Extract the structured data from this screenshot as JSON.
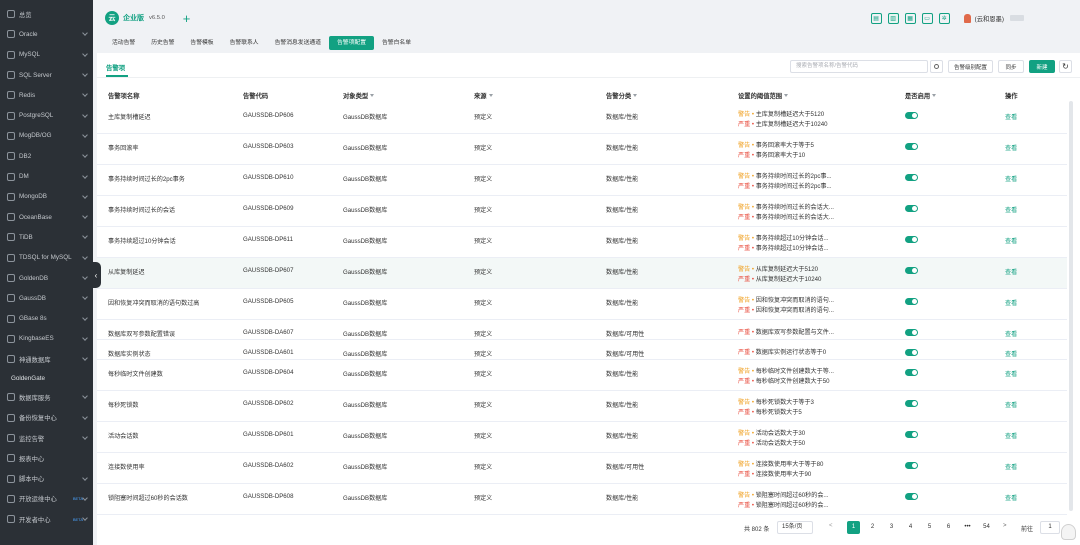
{
  "sidebar": {
    "items": [
      {
        "label": "总览",
        "icon": "dashboard-icon",
        "chevron": false
      },
      {
        "label": "Oracle",
        "icon": "oracle-icon",
        "chevron": true
      },
      {
        "label": "MySQL",
        "icon": "mysql-icon",
        "chevron": true
      },
      {
        "label": "SQL Server",
        "icon": "sqlserver-icon",
        "chevron": true
      },
      {
        "label": "Redis",
        "icon": "redis-icon",
        "chevron": true
      },
      {
        "label": "PostgreSQL",
        "icon": "postgresql-icon",
        "chevron": true
      },
      {
        "label": "MogDB/OG",
        "icon": "mogdb-icon",
        "chevron": true
      },
      {
        "label": "DB2",
        "icon": "db2-icon",
        "chevron": true
      },
      {
        "label": "DM",
        "icon": "dm-icon",
        "chevron": true
      },
      {
        "label": "MongoDB",
        "icon": "mongodb-icon",
        "chevron": true
      },
      {
        "label": "OceanBase",
        "icon": "oceanbase-icon",
        "chevron": true
      },
      {
        "label": "TiDB",
        "icon": "tidb-icon",
        "chevron": true
      },
      {
        "label": "TDSQL for MySQL",
        "icon": "tdsql-icon",
        "chevron": true
      },
      {
        "label": "GoldenDB",
        "icon": "goldendb-icon",
        "chevron": true
      },
      {
        "label": "GaussDB",
        "icon": "gaussdb-icon",
        "chevron": true
      },
      {
        "label": "GBase 8s",
        "icon": "gbase-icon",
        "chevron": true
      },
      {
        "label": "KingbaseES",
        "icon": "kingbase-icon",
        "chevron": true
      },
      {
        "label": "神通数据库",
        "icon": "shentong-icon",
        "chevron": true
      },
      {
        "label": "GoldenGate",
        "icon": "",
        "chevron": false,
        "plain": true
      },
      {
        "label": "数据库服务",
        "icon": "db-service-icon",
        "chevron": true
      },
      {
        "label": "备份恢复中心",
        "icon": "backup-icon",
        "chevron": true
      },
      {
        "label": "监控告警",
        "icon": "alarm-icon",
        "chevron": true
      },
      {
        "label": "报表中心",
        "icon": "report-icon",
        "chevron": false
      },
      {
        "label": "脚本中心",
        "icon": "script-icon",
        "chevron": true
      },
      {
        "label": "开放运维中心",
        "icon": "ops-icon",
        "chevron": true,
        "beta": "BETA"
      },
      {
        "label": "开发者中心",
        "icon": "dev-icon",
        "chevron": true,
        "beta": "BETA"
      }
    ]
  },
  "header": {
    "brand": "企业版",
    "logo_char": "云",
    "version": "v6.5.0",
    "add_tab": "+",
    "user": "(云和恩墨)"
  },
  "tabs": [
    {
      "label": "活动告警",
      "active": false
    },
    {
      "label": "历史告警",
      "active": false
    },
    {
      "label": "告警模板",
      "active": false
    },
    {
      "label": "告警联系人",
      "active": false
    },
    {
      "label": "告警消息发送通道",
      "active": false
    },
    {
      "label": "告警项配置",
      "active": true
    },
    {
      "label": "告警白名单",
      "active": false
    }
  ],
  "panel": {
    "title": "告警项",
    "search_placeholder": "搜索告警项名称/告警代码",
    "btn_level": "告警级别配置",
    "btn_sync": "同步",
    "btn_add": "新建",
    "btn_refresh": "↻"
  },
  "table": {
    "columns": [
      "告警项名称",
      "告警代码",
      "对象类型",
      "来源",
      "告警分类",
      "设置的阈值范围",
      "是否启用",
      "操作"
    ],
    "rows": [
      {
        "name": "主库复制槽延迟",
        "code": "GAUSSDB-DP606",
        "type": "GaussDB数据库",
        "source": "预定义",
        "category": "数据库/性能",
        "thresholds": [
          {
            "level": "警告",
            "text": "主库复制槽延迟大于5120"
          },
          {
            "level": "严重",
            "text": "主库复制槽延迟大于10240"
          }
        ],
        "enabled": true,
        "action": "查看"
      },
      {
        "name": "事务回滚率",
        "code": "GAUSSDB-DP603",
        "type": "GaussDB数据库",
        "source": "预定义",
        "category": "数据库/性能",
        "thresholds": [
          {
            "level": "警告",
            "text": "事务回滚率大于等于5"
          },
          {
            "level": "严重",
            "text": "事务回滚率大于10"
          }
        ],
        "enabled": true,
        "action": "查看"
      },
      {
        "name": "事务持续时间过长的2pc事务",
        "code": "GAUSSDB-DP610",
        "type": "GaussDB数据库",
        "source": "预定义",
        "category": "数据库/性能",
        "thresholds": [
          {
            "level": "警告",
            "text": "事务持续时间过长的2pc事..."
          },
          {
            "level": "严重",
            "text": "事务持续时间过长的2pc事..."
          }
        ],
        "enabled": true,
        "action": "查看"
      },
      {
        "name": "事务持续时间过长的会话",
        "code": "GAUSSDB-DP609",
        "type": "GaussDB数据库",
        "source": "预定义",
        "category": "数据库/性能",
        "thresholds": [
          {
            "level": "警告",
            "text": "事务持续时间过长的会话大..."
          },
          {
            "level": "严重",
            "text": "事务持续时间过长的会话大..."
          }
        ],
        "enabled": true,
        "action": "查看"
      },
      {
        "name": "事务持续超过10分钟会话",
        "code": "GAUSSDB-DP611",
        "type": "GaussDB数据库",
        "source": "预定义",
        "category": "数据库/性能",
        "thresholds": [
          {
            "level": "警告",
            "text": "事务持续超过10分钟会话..."
          },
          {
            "level": "严重",
            "text": "事务持续超过10分钟会话..."
          }
        ],
        "enabled": true,
        "action": "查看"
      },
      {
        "name": "从库复制延迟",
        "code": "GAUSSDB-DP607",
        "type": "GaussDB数据库",
        "source": "预定义",
        "category": "数据库/性能",
        "thresholds": [
          {
            "level": "警告",
            "text": "从库复制延迟大于5120"
          },
          {
            "level": "严重",
            "text": "从库复制延迟大于10240"
          }
        ],
        "enabled": true,
        "action": "查看",
        "highlight": true
      },
      {
        "name": "因和恢复冲突而取消的语句数过高",
        "code": "GAUSSDB-DP605",
        "type": "GaussDB数据库",
        "source": "预定义",
        "category": "数据库/性能",
        "thresholds": [
          {
            "level": "警告",
            "text": "因和恢复冲突而取消的语句..."
          },
          {
            "level": "严重",
            "text": "因和恢复冲突而取消的语句..."
          }
        ],
        "enabled": true,
        "action": "查看"
      },
      {
        "name": "数据库双写参数配置错误",
        "code": "GAUSSDB-DA607",
        "type": "GaussDB数据库",
        "source": "预定义",
        "category": "数据库/可用性",
        "thresholds": [
          {
            "level": "严重",
            "text": "数据库双写参数配置与文件..."
          }
        ],
        "enabled": true,
        "action": "查看"
      },
      {
        "name": "数据库实例状态",
        "code": "GAUSSDB-DA601",
        "type": "GaussDB数据库",
        "source": "预定义",
        "category": "数据库/可用性",
        "thresholds": [
          {
            "level": "严重",
            "text": "数据库实例运行状态等于0"
          }
        ],
        "enabled": true,
        "action": "查看"
      },
      {
        "name": "每秒临时文件创建数",
        "code": "GAUSSDB-DP604",
        "type": "GaussDB数据库",
        "source": "预定义",
        "category": "数据库/性能",
        "thresholds": [
          {
            "level": "警告",
            "text": "每秒临时文件创建数大于等..."
          },
          {
            "level": "严重",
            "text": "每秒临时文件创建数大于50"
          }
        ],
        "enabled": true,
        "action": "查看"
      },
      {
        "name": "每秒死锁数",
        "code": "GAUSSDB-DP602",
        "type": "GaussDB数据库",
        "source": "预定义",
        "category": "数据库/性能",
        "thresholds": [
          {
            "level": "警告",
            "text": "每秒死锁数大于等于3"
          },
          {
            "level": "严重",
            "text": "每秒死锁数大于5"
          }
        ],
        "enabled": true,
        "action": "查看"
      },
      {
        "name": "活动会话数",
        "code": "GAUSSDB-DP601",
        "type": "GaussDB数据库",
        "source": "预定义",
        "category": "数据库/性能",
        "thresholds": [
          {
            "level": "警告",
            "text": "活动会话数大于30"
          },
          {
            "level": "严重",
            "text": "活动会话数大于50"
          }
        ],
        "enabled": true,
        "action": "查看"
      },
      {
        "name": "连接数使用率",
        "code": "GAUSSDB-DA602",
        "type": "GaussDB数据库",
        "source": "预定义",
        "category": "数据库/可用性",
        "thresholds": [
          {
            "level": "警告",
            "text": "连接数使用率大于等于80"
          },
          {
            "level": "严重",
            "text": "连接数使用率大于90"
          }
        ],
        "enabled": true,
        "action": "查看"
      },
      {
        "name": "锁阻塞时间超过60秒的会话数",
        "code": "GAUSSDB-DP608",
        "type": "GaussDB数据库",
        "source": "预定义",
        "category": "数据库/性能",
        "thresholds": [
          {
            "level": "警告",
            "text": "锁阻塞时间超过60秒的会..."
          },
          {
            "level": "严重",
            "text": "锁阻塞时间超过60秒的会..."
          }
        ],
        "enabled": true,
        "action": "查看"
      }
    ],
    "threshold_sep": " • "
  },
  "pagination": {
    "total": "共 802 条",
    "page_size": "15条/页",
    "prev": "<",
    "pages": [
      "1",
      "2",
      "3",
      "4",
      "5",
      "6",
      "•••",
      "54"
    ],
    "current": "1",
    "next": ">",
    "goto_label": "前往",
    "goto_value": "1"
  },
  "colors": {
    "accent": "#12a182",
    "warning": "#f0a020",
    "severe": "#e84a3b",
    "sidebar_bg": "#2b3036"
  }
}
